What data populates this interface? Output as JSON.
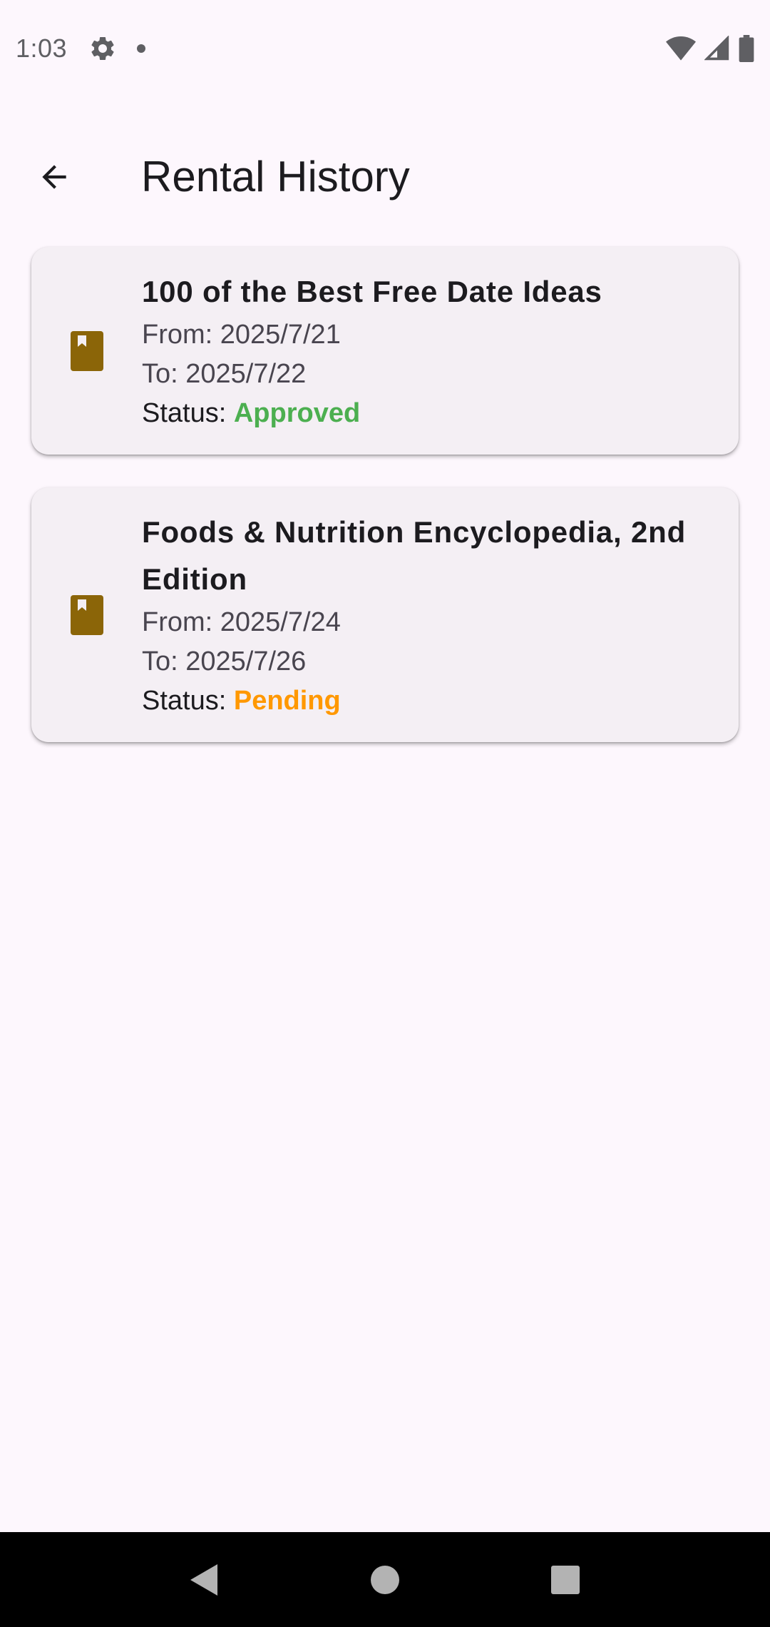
{
  "status_bar": {
    "time": "1:03"
  },
  "app_bar": {
    "title": "Rental History"
  },
  "rentals": [
    {
      "title": "100 of the Best Free Date Ideas",
      "from_label": "From: 2025/7/21",
      "to_label": "To: 2025/7/22",
      "status_prefix": "Status: ",
      "status": "Approved",
      "status_color": "#4CAF50"
    },
    {
      "title": "Foods & Nutrition Encyclopedia, 2nd Edition",
      "from_label": "From: 2025/7/24",
      "to_label": "To: 2025/7/26",
      "status_prefix": "Status: ",
      "status": "Pending",
      "status_color": "#FF9800"
    }
  ],
  "colors": {
    "background": "#FDF7FD",
    "card": "#F4EFF4",
    "book_icon": "#8B6508",
    "approved": "#4CAF50",
    "pending": "#FF9800"
  },
  "icons": {
    "back": "arrow-back-icon",
    "book": "book-icon",
    "settings": "gear-icon",
    "wifi": "wifi-icon",
    "signal": "signal-icon",
    "battery": "battery-icon"
  }
}
